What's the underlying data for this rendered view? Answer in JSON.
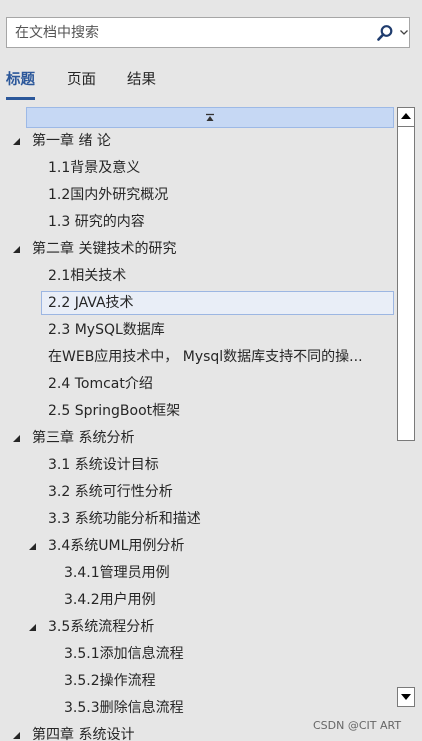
{
  "search": {
    "placeholder": "在文档中搜索"
  },
  "tabs": [
    {
      "label": "标题",
      "active": true
    },
    {
      "label": "页面",
      "active": false
    },
    {
      "label": "结果",
      "active": false
    }
  ],
  "tree": [
    {
      "label": "第一章 绪 论",
      "level": 1,
      "expanded": true
    },
    {
      "label": "1.1背景及意义",
      "level": 2
    },
    {
      "label": "1.2国内外研究概况",
      "level": 2
    },
    {
      "label": "1.3 研究的内容",
      "level": 2
    },
    {
      "label": "第二章 关键技术的研究",
      "level": 1,
      "expanded": true
    },
    {
      "label": "2.1相关技术",
      "level": 2
    },
    {
      "label": "2.2 JAVA技术",
      "level": 2,
      "selected": true
    },
    {
      "label": "2.3 MySQL数据库",
      "level": 2
    },
    {
      "label": "在WEB应用技术中， Mysql数据库支持不同的操...",
      "level": 2
    },
    {
      "label": "2.4 Tomcat介绍",
      "level": 2
    },
    {
      "label": "2.5 SpringBoot框架",
      "level": 2
    },
    {
      "label": "第三章 系统分析",
      "level": 1,
      "expanded": true
    },
    {
      "label": "3.1 系统设计目标",
      "level": 2
    },
    {
      "label": "3.2 系统可行性分析",
      "level": 2
    },
    {
      "label": "3.3 系统功能分析和描述",
      "level": 2
    },
    {
      "label": "3.4系统UML用例分析",
      "level": 2,
      "expanded": true
    },
    {
      "label": "3.4.1管理员用例",
      "level": 3
    },
    {
      "label": "3.4.2用户用例",
      "level": 3
    },
    {
      "label": "3.5系统流程分析",
      "level": 2,
      "expanded": true
    },
    {
      "label": "3.5.1添加信息流程",
      "level": 3
    },
    {
      "label": "3.5.2操作流程",
      "level": 3
    },
    {
      "label": "3.5.3删除信息流程",
      "level": 3
    },
    {
      "label": "第四章 系统设计",
      "level": 1,
      "expanded": true
    }
  ],
  "watermark": "CSDN @CIT ART",
  "colors": {
    "accent": "#2b579a",
    "selection": "#c6d8f4"
  }
}
